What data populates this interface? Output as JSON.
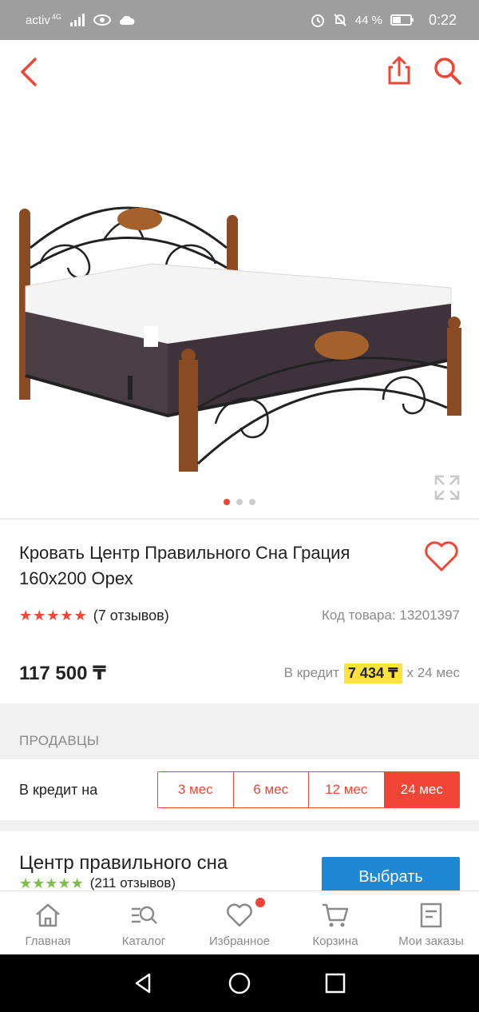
{
  "status_bar": {
    "carrier": "activ",
    "network": "4G",
    "battery": "44 %",
    "time": "0:22"
  },
  "product": {
    "title": "Кровать Центр Правильного Сна Грация 160х200 Орех",
    "rating_stars": 5,
    "reviews": "(7 отзывов)",
    "sku": "Код товара: 13201397",
    "price": "117 500 ₸",
    "credit_prefix": "В кредит",
    "credit_amount": "7 434 ₸",
    "credit_suffix": "х 24 мес",
    "gallery_pages": 3,
    "gallery_active": 1
  },
  "sellers": {
    "section_label": "ПРОДАВЦЫ",
    "credit_label": "В кредит на",
    "terms": [
      "3 мес",
      "6 мес",
      "12 мес",
      "24 мес"
    ],
    "active_term": "24 мес",
    "seller": {
      "name": "Центр правильного сна",
      "reviews": "(211 отзывов)",
      "choose_label": "Выбрать"
    }
  },
  "bottom_nav": {
    "items": [
      {
        "label": "Главная",
        "icon": "home-icon"
      },
      {
        "label": "Каталог",
        "icon": "catalog-icon"
      },
      {
        "label": "Избранное",
        "icon": "heart-icon"
      },
      {
        "label": "Корзина",
        "icon": "cart-icon"
      },
      {
        "label": "Мои заказы",
        "icon": "orders-icon"
      }
    ]
  },
  "colors": {
    "accent": "#f14635",
    "highlight": "#ffe33a",
    "button_blue": "#1e88d4",
    "seller_stars": "#7bc043"
  }
}
